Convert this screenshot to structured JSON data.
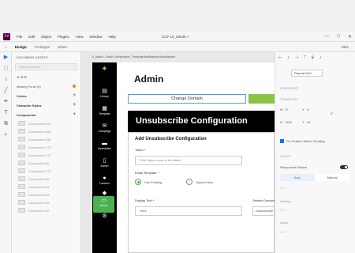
{
  "menubar": {
    "app_logo": "Xd",
    "items": [
      "File",
      "Edit",
      "Object",
      "Plugins",
      "View",
      "Window",
      "Help"
    ],
    "doc_title": "CCP UI_X0035 ˅",
    "controls": [
      "—",
      "□",
      "✕"
    ]
  },
  "tabs": [
    "Design",
    "Prototype",
    "Share"
  ],
  "zoom": "35%",
  "tools": [
    "▶",
    "□",
    "○",
    "╱",
    "✒",
    "T",
    "⧉",
    "⌕"
  ],
  "layers": {
    "header": "DOCUMENT ASSETS",
    "search_placeholder": "Search all Assets",
    "missing_fonts": "Missing Fonts (5)",
    "colors": "Colors",
    "character_styles": "Character Styles",
    "components": "Components",
    "component_items": [
      "Component 191",
      "Component 189",
      "Component 188",
      "Component 173",
      "Component 171",
      "Component 50",
      "Component 172",
      "Component 52",
      "Component 44",
      "Component 43",
      "Component 45",
      "Component 22"
    ]
  },
  "artboard": {
    "label": "4_Admin - Email Configuration - Template/Notifications/Unsubscribe",
    "nav": [
      "Library",
      "Template",
      "Campaign",
      "Newsletter",
      "Admin",
      "Landers",
      "Report",
      "Admin",
      "Settings"
    ],
    "admin_title": "Admin",
    "change_domain": "Change Domain",
    "unsub_header": "Unsubscribe Configuration",
    "form_title": "Add Unsubscribe Configuration",
    "token_label": "Token *",
    "token_placeholder": "Give token name to be added",
    "email_label": "Email Template *",
    "radio_existing": "Use Existing",
    "radio_new": "Upload New",
    "display_label": "Display Text *",
    "display_value": "Here",
    "sender_label": "Sender Domain",
    "sender_value": "Unsubscribe"
  },
  "props": {
    "repeat_grid": "Repeat Grid",
    "component_head": "COMPONENT",
    "transform_head": "TRANSFORM",
    "w_label": "W",
    "w_value": "72",
    "x_label": "X",
    "x_value": "0",
    "h_label": "H",
    "h_value": "1324",
    "y_label": "Y",
    "y_value": "20",
    "angle_value": "0°",
    "fix_position": "Fix Position When Scrolling",
    "layout_head": "LAYOUT",
    "responsive_resize": "Responsive Resize",
    "seg_auto": "Auto",
    "seg_manual": "Manual",
    "padding_head": "Padding",
    "stacks_head": "Stacks"
  },
  "colors": {
    "accent_green": "#4caf50",
    "selection_blue": "#1473e6",
    "brand_magenta": "#470137"
  }
}
